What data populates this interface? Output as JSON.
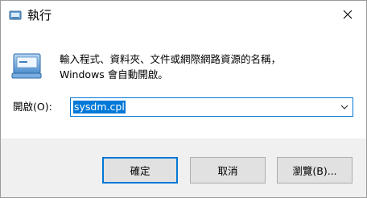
{
  "window": {
    "title": "執行",
    "close_icon": "close-icon"
  },
  "description": {
    "line1": "輸入程式、資料夾、文件或網際網路資源的名稱，",
    "line2": "Windows 會自動開啟。"
  },
  "open": {
    "label": "開啟(O):",
    "value": "sysdm.cpl"
  },
  "buttons": {
    "ok": "確定",
    "cancel": "取消",
    "browse": "瀏覽(B)..."
  },
  "colors": {
    "accent": "#0078d7",
    "footer_bg": "#f0f0f0",
    "button_bg": "#e1e1e1"
  }
}
